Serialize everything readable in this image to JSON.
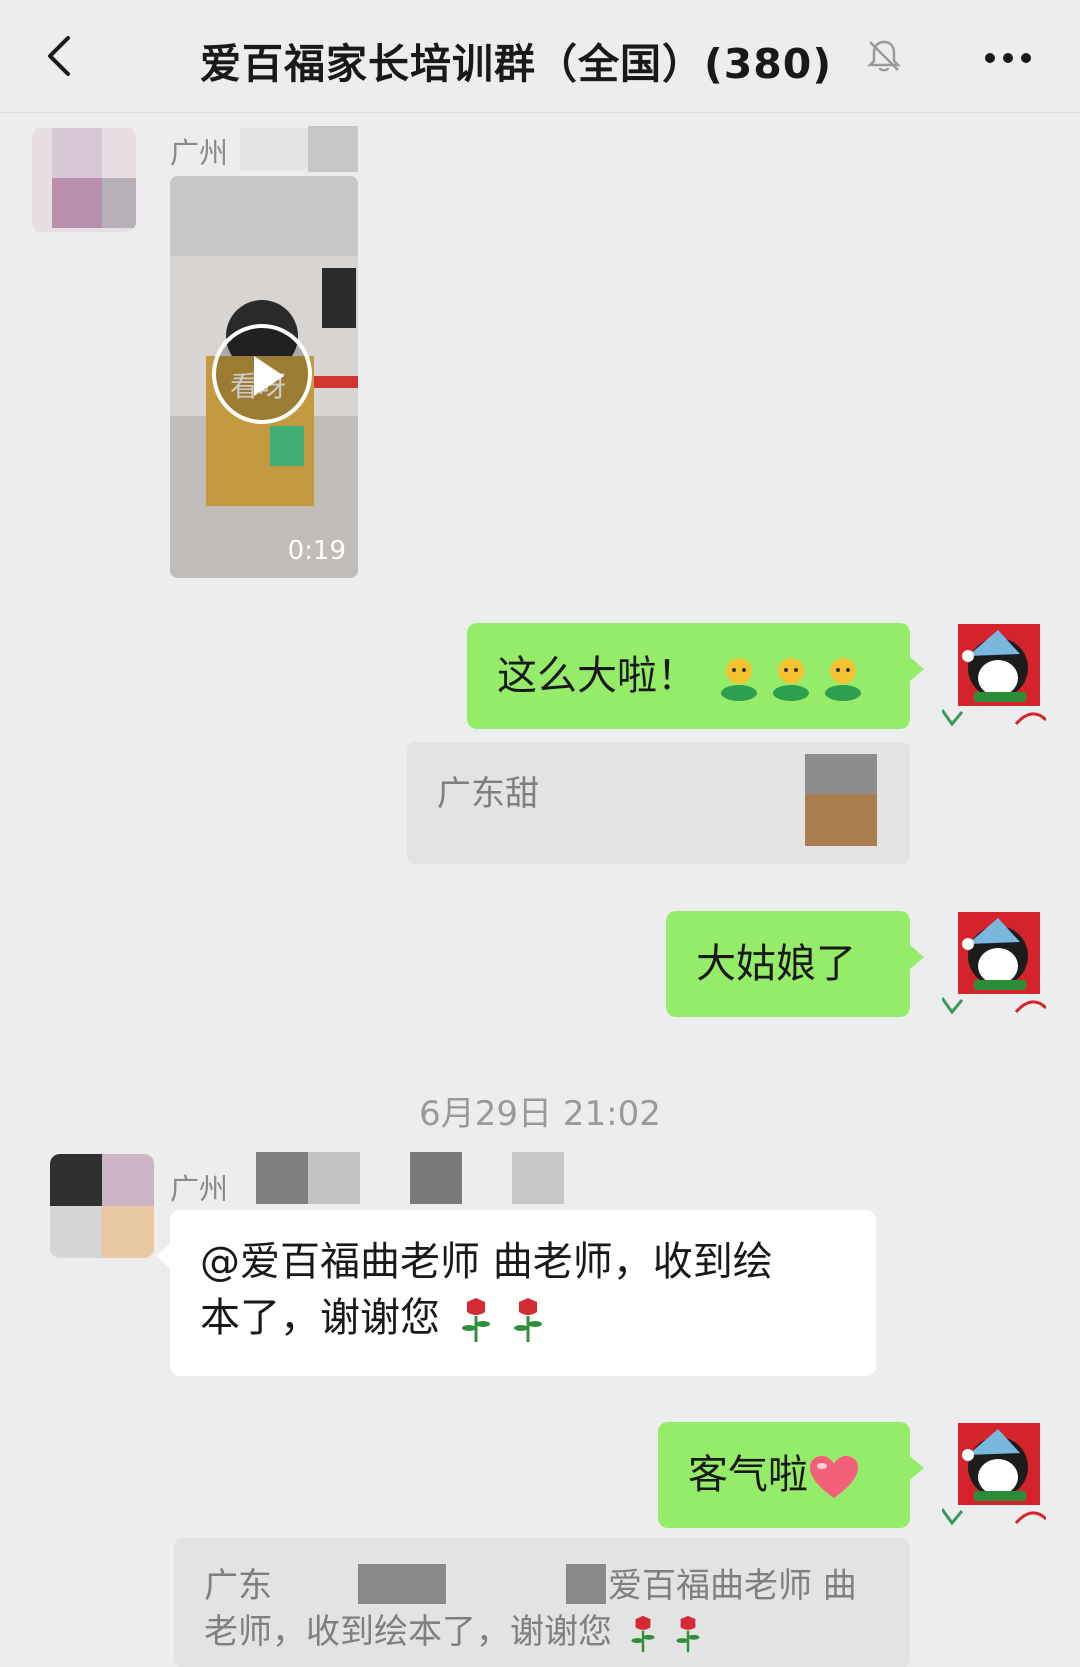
{
  "header": {
    "title": "爱百福家长培训群（全国）(380)",
    "back_icon": "chevron-left-icon",
    "mute_icon": "bell-off-icon",
    "more_icon": "more-dots-icon"
  },
  "messages": {
    "m1": {
      "sender": "广州",
      "video_duration": "0:19",
      "video_book_text": "看呀"
    },
    "m2": {
      "text": "这么大啦！"
    },
    "m2_quote": {
      "text": "广东甜"
    },
    "m3": {
      "text": "大姑娘了"
    },
    "time_separator": "6月29日 21:02",
    "m4": {
      "sender": "广州",
      "text_line1": "@爱百福曲老师 曲老师，收到绘",
      "text_line2": "本了，谢谢您"
    },
    "m5": {
      "text": "客气啦"
    },
    "m5_quote": {
      "line1_start": "广东",
      "line1_end": "爱百福曲老师 曲",
      "line2": "老师，收到绘本了，谢谢您"
    }
  },
  "colors": {
    "background": "#ededed",
    "outgoing_bubble": "#95ec69",
    "incoming_bubble": "#ffffff",
    "quote_bg": "#e3e3e3"
  }
}
